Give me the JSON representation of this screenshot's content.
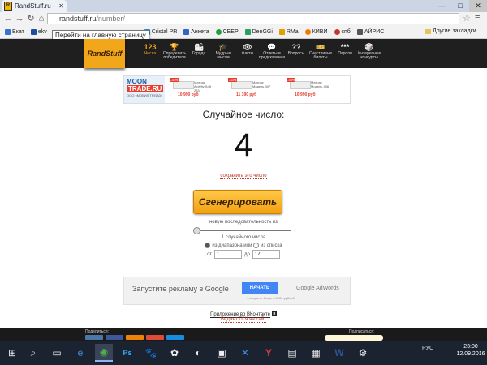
{
  "browser": {
    "tab_title": "RandStuff.ru - генератор",
    "url_host": "randstuff.ru",
    "url_path": "/number/",
    "tooltip": "Перейти на главную страницу",
    "window_buttons": [
      "—",
      "□",
      "✕"
    ],
    "bookmarks": [
      {
        "label": "Екат",
        "color": "#3b6fd1"
      },
      {
        "label": "ekv",
        "color": "#1e4e9e"
      },
      {
        "label": "Cristal PR",
        "color": "#2a83d6"
      },
      {
        "label": "Анкета",
        "color": "#3466c4"
      },
      {
        "label": "СБЕР",
        "color": "#1f9e3a"
      },
      {
        "label": "DenGGi",
        "color": "#2aa060"
      },
      {
        "label": "RMa",
        "color": "#e0a000"
      },
      {
        "label": "КИВИ",
        "color": "#f07a00"
      },
      {
        "label": "спб",
        "color": "#c0392b"
      },
      {
        "label": "АЙРИС",
        "color": "#555555"
      }
    ],
    "other_bookmarks": "Другие закладки"
  },
  "site": {
    "logo": "RandStuff",
    "nav": [
      {
        "icon": "123",
        "label": "Числа",
        "active": true
      },
      {
        "icon": "🏆",
        "label": "Определить победителя"
      },
      {
        "icon": "🏙",
        "label": "Города"
      },
      {
        "icon": "🎓",
        "label": "Мудрые мысли"
      },
      {
        "icon": "👁",
        "label": "Факты"
      },
      {
        "icon": "💬",
        "label": "Ответы и предсказания"
      },
      {
        "icon": "??",
        "label": "Вопросы"
      },
      {
        "icon": "🎫",
        "label": "Счастливые билеты"
      },
      {
        "icon": "***",
        "label": "Пароли"
      },
      {
        "icon": "🎲",
        "label": "Интересные конкурсы"
      }
    ]
  },
  "ad_top": {
    "brand_1": "MOON",
    "brand_2": "TRADE.RU",
    "desc": "ООО «МОБИЛ ТРЕЙД»",
    "products": [
      {
        "discount": "-33%",
        "name": "Матрас Activity Soft 233",
        "price": "10 990 руб"
      },
      {
        "discount": "-33%",
        "name": "Матрас Модель 307",
        "price": "11 390 руб"
      },
      {
        "discount": "-33%",
        "name": "Матрас Модель 406",
        "price": "10 990 руб"
      }
    ]
  },
  "main": {
    "title": "Случайное число:",
    "number": "4",
    "save_link": "сохранить это число",
    "generate_button": "Сгенерировать",
    "sequence_label": "новую последовательность из",
    "count_label": "1 случайного числа",
    "radio_range": "из диапазона",
    "radio_or": "или",
    "radio_list": "из списка",
    "from_label": "от",
    "from_value": "1",
    "to_label": "до",
    "to_value": "17"
  },
  "ad_bottom": {
    "text": "Запустите рекламу в Google",
    "button": "НАЧАТЬ",
    "note": "+ получите бонус в 3000 рублей",
    "brand": "Google AdWords"
  },
  "footer_links": {
    "vk_app": "Приложение во ВКонтакте",
    "widget": "Виджет ГСЧ на сайт"
  },
  "footer": {
    "share": "Поделиться:",
    "subscribe": "Подписаться:"
  },
  "taskbar": {
    "icons": [
      "⊞",
      "⌕",
      "▭",
      "e",
      "◉",
      "Ps",
      "🐾",
      "✿",
      "◐",
      "▣",
      "✕",
      "Y",
      "▤",
      "▦",
      "W",
      "⚙"
    ],
    "tray": "РУС",
    "time": "23:00",
    "date": "12.09.2016"
  }
}
